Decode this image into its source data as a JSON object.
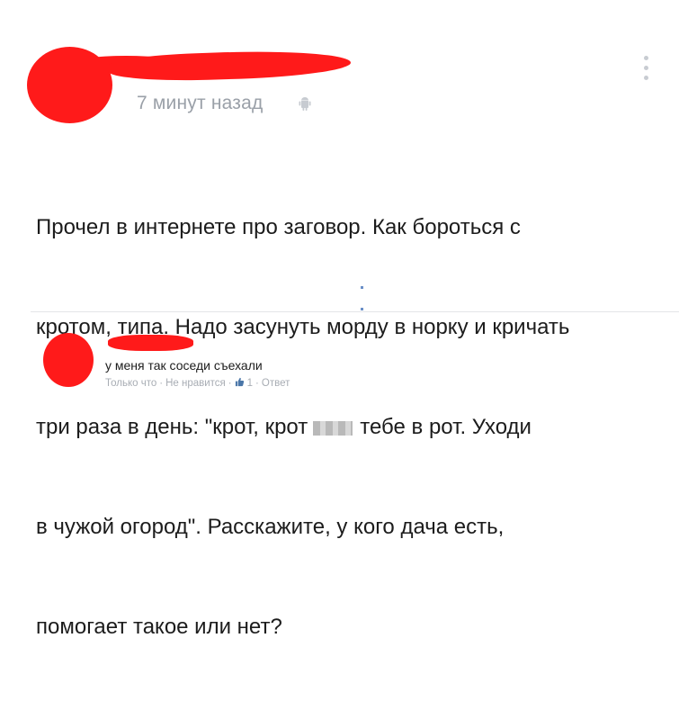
{
  "post": {
    "time": "7 минут назад",
    "lines": [
      "Прочел в интернете про заговор. Как бороться с",
      "кротом, типа. Надо засунуть морду в норку и кричать",
      "три раза в день: \"крот, крот",
      "тебе в рот. Уходи",
      "в чужой огород\". Расскажите, у кого дача есть,",
      "помогает такое или нет?"
    ]
  },
  "comment": {
    "text": "у меня так соседи съехали",
    "time": "Только что",
    "unlike": "Не нравится",
    "likes": "1",
    "reply": "Ответ"
  },
  "colors": {
    "redaction": "#ff1a1a",
    "meta": "#a8adb4",
    "like": "#4a76a8"
  }
}
